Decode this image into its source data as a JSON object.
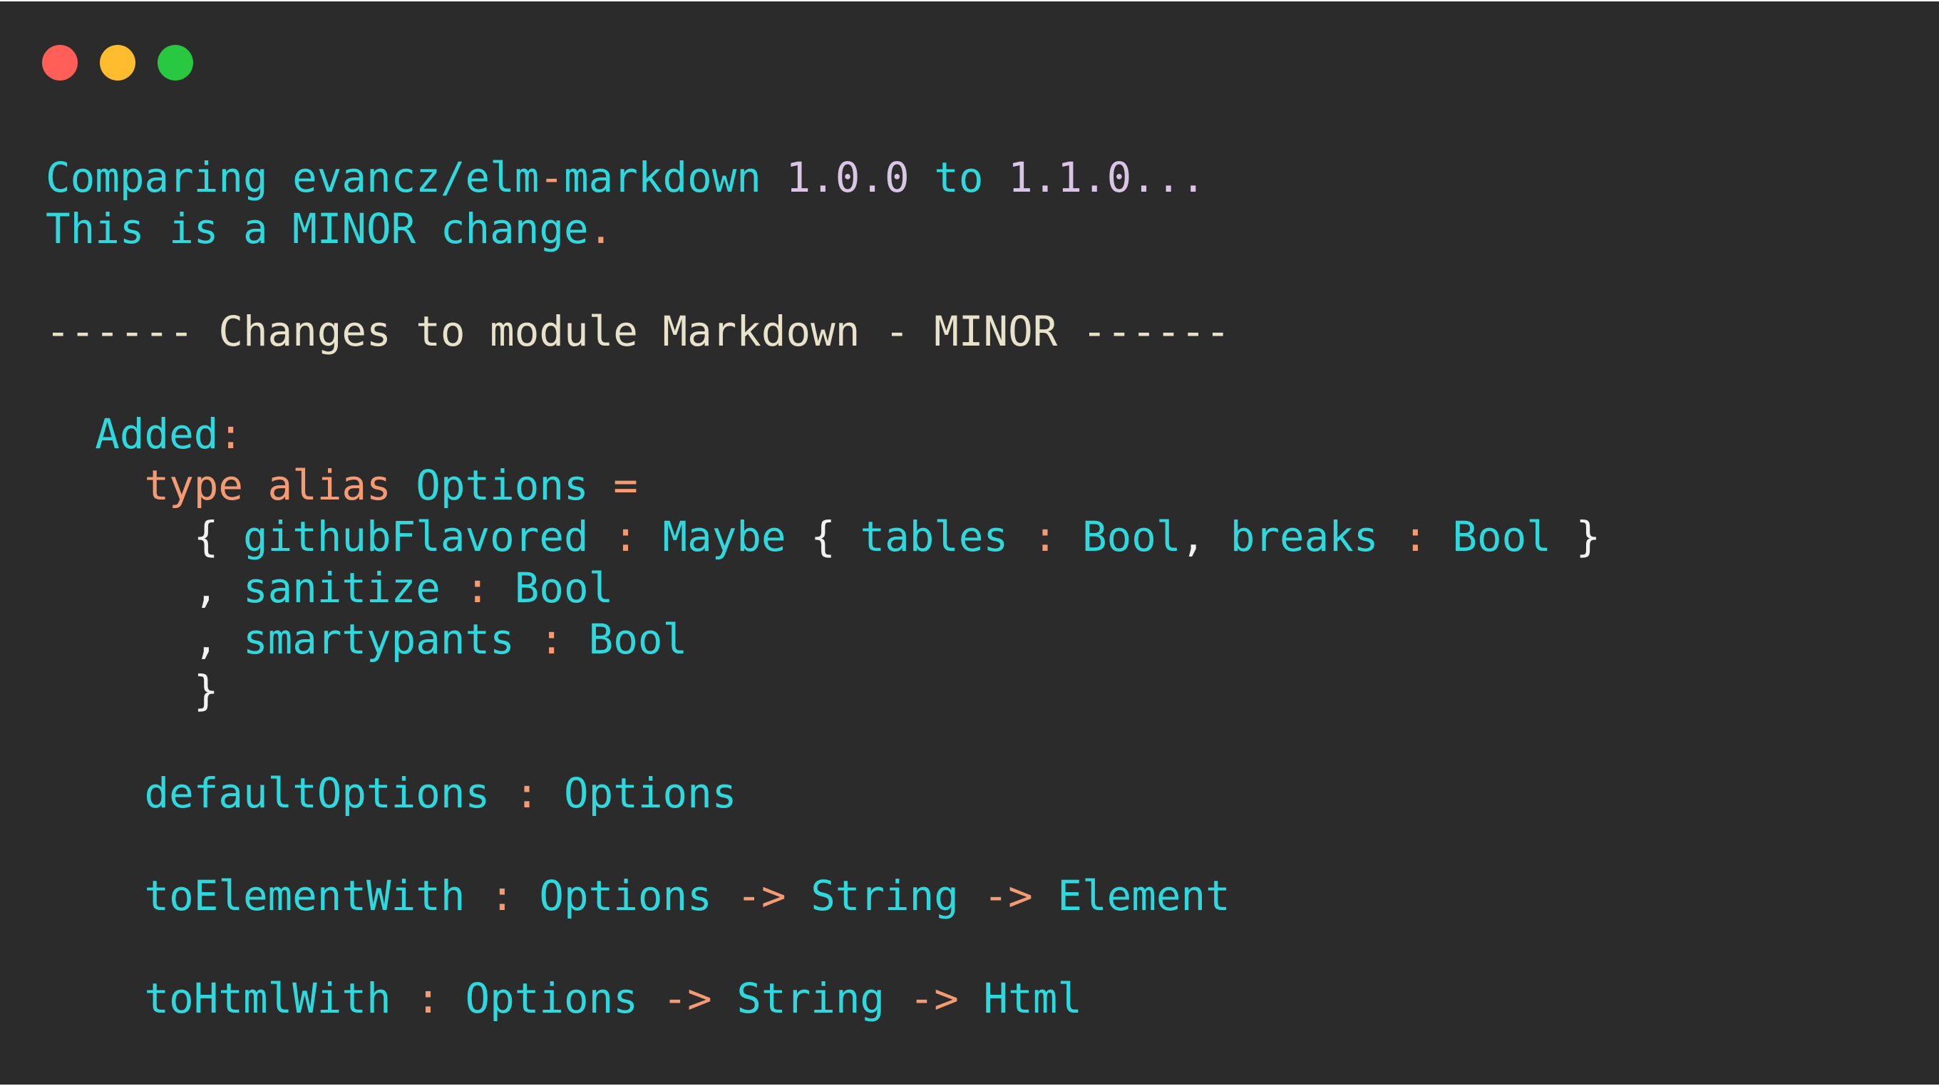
{
  "window_controls": {
    "close_color": "#ff5f57",
    "minimize_color": "#febc2e",
    "zoom_color": "#28c840"
  },
  "terminal": {
    "lines": [
      {
        "tokens": [
          {
            "text": "Comparing evancz/elm",
            "style": "cyan"
          },
          {
            "text": "-",
            "style": "orange"
          },
          {
            "text": "markdown ",
            "style": "cyan"
          },
          {
            "text": "1.0.0",
            "style": "lav"
          },
          {
            "text": " to ",
            "style": "cyan"
          },
          {
            "text": "1.1.0...",
            "style": "lav"
          }
        ]
      },
      {
        "tokens": [
          {
            "text": "This is a MINOR change",
            "style": "cyan"
          },
          {
            "text": ".",
            "style": "orange"
          }
        ]
      },
      {
        "tokens": []
      },
      {
        "tokens": [
          {
            "text": "------ Changes to module Markdown - MINOR ------",
            "style": "dim"
          }
        ]
      },
      {
        "tokens": []
      },
      {
        "tokens": [
          {
            "text": "  Added",
            "style": "cyan"
          },
          {
            "text": ":",
            "style": "orange"
          }
        ]
      },
      {
        "tokens": [
          {
            "text": "    type alias ",
            "style": "orange"
          },
          {
            "text": "Options ",
            "style": "cyan"
          },
          {
            "text": "=",
            "style": "orange"
          }
        ]
      },
      {
        "tokens": [
          {
            "text": "      { ",
            "style": "white"
          },
          {
            "text": "githubFlavored ",
            "style": "cyan"
          },
          {
            "text": ": ",
            "style": "orange"
          },
          {
            "text": "Maybe ",
            "style": "cyan"
          },
          {
            "text": "{ ",
            "style": "white"
          },
          {
            "text": "tables ",
            "style": "cyan"
          },
          {
            "text": ": ",
            "style": "orange"
          },
          {
            "text": "Bool",
            "style": "cyan"
          },
          {
            "text": ", ",
            "style": "white"
          },
          {
            "text": "breaks ",
            "style": "cyan"
          },
          {
            "text": ": ",
            "style": "orange"
          },
          {
            "text": "Bool ",
            "style": "cyan"
          },
          {
            "text": "}",
            "style": "white"
          }
        ]
      },
      {
        "tokens": [
          {
            "text": "      , ",
            "style": "white"
          },
          {
            "text": "sanitize ",
            "style": "cyan"
          },
          {
            "text": ": ",
            "style": "orange"
          },
          {
            "text": "Bool",
            "style": "cyan"
          }
        ]
      },
      {
        "tokens": [
          {
            "text": "      , ",
            "style": "white"
          },
          {
            "text": "smartypants ",
            "style": "cyan"
          },
          {
            "text": ": ",
            "style": "orange"
          },
          {
            "text": "Bool",
            "style": "cyan"
          }
        ]
      },
      {
        "tokens": [
          {
            "text": "      }",
            "style": "white"
          }
        ]
      },
      {
        "tokens": []
      },
      {
        "tokens": [
          {
            "text": "    defaultOptions ",
            "style": "cyan"
          },
          {
            "text": ": ",
            "style": "orange"
          },
          {
            "text": "Options",
            "style": "cyan"
          }
        ]
      },
      {
        "tokens": []
      },
      {
        "tokens": [
          {
            "text": "    toElementWith ",
            "style": "cyan"
          },
          {
            "text": ": ",
            "style": "orange"
          },
          {
            "text": "Options ",
            "style": "cyan"
          },
          {
            "text": "-> ",
            "style": "orange"
          },
          {
            "text": "String ",
            "style": "cyan"
          },
          {
            "text": "-> ",
            "style": "orange"
          },
          {
            "text": "Element",
            "style": "cyan"
          }
        ]
      },
      {
        "tokens": []
      },
      {
        "tokens": [
          {
            "text": "    toHtmlWith ",
            "style": "cyan"
          },
          {
            "text": ": ",
            "style": "orange"
          },
          {
            "text": "Options ",
            "style": "cyan"
          },
          {
            "text": "-> ",
            "style": "orange"
          },
          {
            "text": "String ",
            "style": "cyan"
          },
          {
            "text": "-> ",
            "style": "orange"
          },
          {
            "text": "Html",
            "style": "cyan"
          }
        ]
      }
    ]
  }
}
